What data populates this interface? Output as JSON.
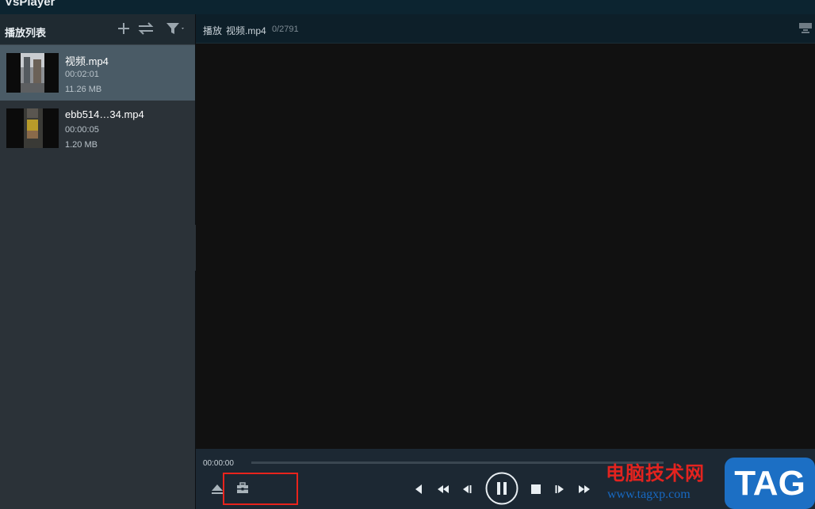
{
  "app": {
    "title": "VsPlayer"
  },
  "sidebar": {
    "title": "播放列表",
    "icons": [
      "add-icon",
      "swap-icon",
      "filter-icon"
    ],
    "items": [
      {
        "name": "视频.mp4",
        "duration": "00:02:01",
        "size": "11.26 MB",
        "selected": true
      },
      {
        "name": "ebb514…34.mp4",
        "duration": "00:00:05",
        "size": "1.20 MB",
        "selected": false
      }
    ]
  },
  "main": {
    "header": {
      "label": "播放",
      "file": "视频.mp4",
      "frames": "0/2791"
    }
  },
  "controls": {
    "time_current": "00:00:00",
    "progress": 0,
    "icons": [
      "eject-icon",
      "toolbox-icon",
      "prev-frame-icon",
      "rewind-icon",
      "step-back-icon",
      "pause-icon",
      "stop-icon",
      "step-forward-icon",
      "fast-forward-icon"
    ]
  },
  "watermark": {
    "cn": "电脑技术网",
    "url": "www.tagxp.com",
    "tag": "TAG"
  },
  "colors": {
    "titlebar": "#0c2430",
    "selected": "#4a5b66",
    "highlight": "#e8231c",
    "tag_blue": "#1c6fc4",
    "wm_red": "#e3231f"
  }
}
